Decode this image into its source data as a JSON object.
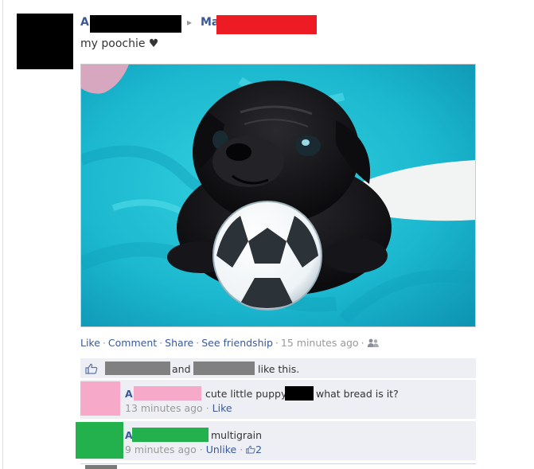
{
  "post": {
    "author_initial": "A",
    "arrow": "▸",
    "recipient_initial": "Ma",
    "message": "my poochie ♥"
  },
  "actions": {
    "like": "Like",
    "comment": "Comment",
    "share": "Share",
    "see_friendship": "See friendship",
    "sep": "·",
    "time": "15 minutes ago",
    "privacy_icon": "friends-icon"
  },
  "likes": {
    "conj": "and",
    "suffix": "like this."
  },
  "comments": [
    {
      "author_initial": "A",
      "text": "cute little puppy",
      "text2": "what bread is it?",
      "time": "13 minutes ago",
      "action": "Like"
    },
    {
      "author_initial": "A",
      "text": "multigrain",
      "time": "9 minutes ago",
      "action": "Unlike",
      "like_count": "2"
    }
  ],
  "colors": {
    "link": "#3b5998",
    "redact_red": "#ed1c24",
    "redact_gray": "#808080",
    "redact_pink": "#f6a9c8",
    "redact_green": "#22b14c",
    "ufi_bg": "#edeff4"
  }
}
